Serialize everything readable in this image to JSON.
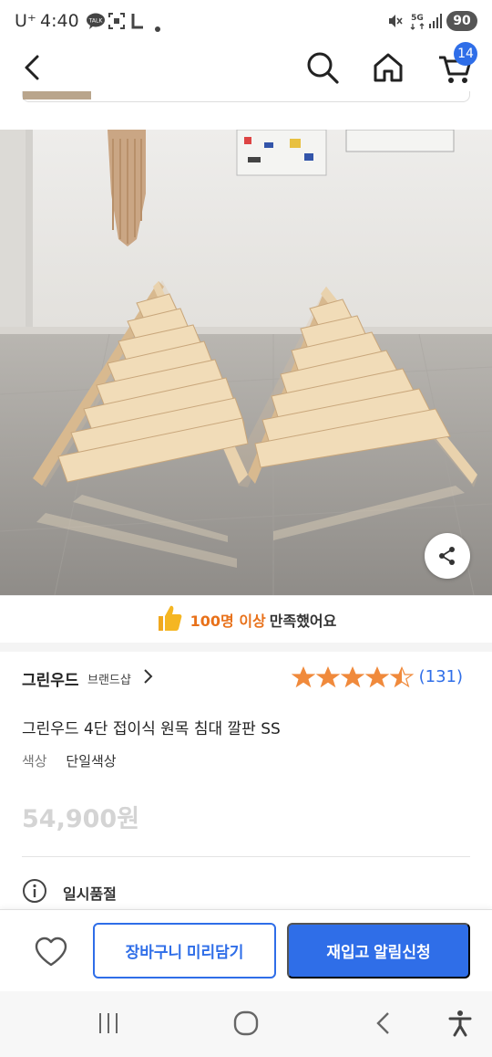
{
  "status_bar": {
    "carrier": "U⁺",
    "time": "4:40",
    "battery": "90",
    "network": "5G"
  },
  "nav": {
    "cart_count": "14",
    "icons": [
      "back-arrow-icon",
      "search-icon",
      "home-icon",
      "cart-icon"
    ]
  },
  "gallery": {
    "page_count": 3,
    "active_index": 0
  },
  "satisfaction": {
    "highlight": "100명 이상",
    "rest": "만족했어요"
  },
  "product": {
    "brand": "그린우드",
    "brand_shop": "브랜드샵",
    "rating": 4.5,
    "review_count": "(131)",
    "title": "그린우드 4단 접이식 원목 침대 깔판 SS",
    "option_label": "색상",
    "option_value": "단일색상",
    "price": "54,900원",
    "stock_status": "일시품절"
  },
  "actions": {
    "cart_label": "장바구니 미리담기",
    "notify_label": "재입고 알림신청"
  },
  "colors": {
    "accent": "#2f6ee8",
    "highlight": "#e8711a",
    "star": "#f08a3c"
  }
}
